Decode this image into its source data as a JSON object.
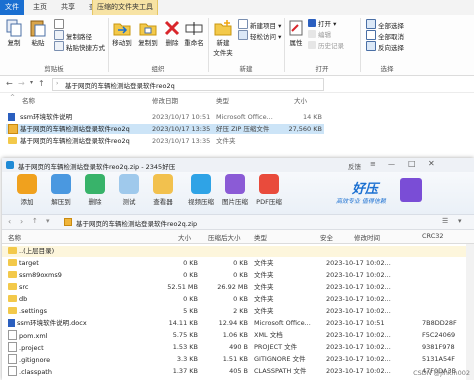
{
  "ribbon": {
    "tabs": [
      "文件",
      "主页",
      "共享",
      "查看",
      "压缩的文件夹工具"
    ],
    "clipboard": {
      "copy": "复制",
      "paste": "粘贴",
      "copy_path": "复制路径",
      "paste_shortcut": "粘贴快捷方式",
      "cut": "剪切",
      "group": "剪贴板"
    },
    "organize": {
      "move_to": "移动到",
      "copy_to": "复制到",
      "delete": "删除",
      "rename": "重命名",
      "group": "组织"
    },
    "new": {
      "new_folder": "新建\n文件夹",
      "new_item": "新建项目",
      "easy_access": "轻松访问",
      "group": "新建"
    },
    "open": {
      "properties": "属性",
      "open": "打开",
      "edit": "编辑",
      "history": "历史记录",
      "group": "打开"
    },
    "select": {
      "select_all": "全部选择",
      "select_none": "全部取消",
      "invert": "反向选择",
      "group": "选择"
    }
  },
  "address": {
    "path": "基于网页的车辆检测站登录软件reo2q"
  },
  "file_list": {
    "headers": [
      "名称",
      "修改日期",
      "类型",
      "大小"
    ],
    "rows": [
      {
        "name": "ssm环境软件说明",
        "date": "2023/10/17 10:51",
        "type": "Microsoft Office...",
        "size": "14 KB"
      },
      {
        "name": "基于网页的车辆检测站登录软件reo2q",
        "date": "2023/10/17 13:35",
        "type": "好压 ZIP 压缩文件",
        "size": "27,560 KB"
      },
      {
        "name": "基于网页的车辆检测站登录软件reo2q",
        "date": "2023/10/17 13:35",
        "type": "文件夹",
        "size": ""
      }
    ]
  },
  "haozip": {
    "title": "基于网页的车辆检测站登录软件reo2q.zip - 2345好压",
    "feedback": "反馈",
    "toolbar": [
      "添加",
      "解压到",
      "删除",
      "测试",
      "查看器",
      "视频压缩",
      "图片压缩",
      "PDF压缩"
    ],
    "brand": "好压",
    "slogan": "高效专业 值得信赖",
    "nav_path": "基于网页的车辆检测站登录软件reo2q.zip",
    "headers": [
      "名称",
      "大小",
      "压缩后大小",
      "类型",
      "安全",
      "修改时间",
      "CRC32"
    ],
    "rows": [
      {
        "name": "..(上层目录)",
        "size": "",
        "packed": "",
        "type": "",
        "date": "",
        "crc": "",
        "kind": "folder"
      },
      {
        "name": "target",
        "size": "0 KB",
        "packed": "0 KB",
        "type": "文件夹",
        "date": "2023-10-17 10:02...",
        "crc": "",
        "kind": "folder"
      },
      {
        "name": "ssm89oxms9",
        "size": "0 KB",
        "packed": "0 KB",
        "type": "文件夹",
        "date": "2023-10-17 10:02...",
        "crc": "",
        "kind": "folder"
      },
      {
        "name": "src",
        "size": "52.51 MB",
        "packed": "26.92 MB",
        "type": "文件夹",
        "date": "2023-10-17 10:02...",
        "crc": "",
        "kind": "folder"
      },
      {
        "name": "db",
        "size": "0 KB",
        "packed": "0 KB",
        "type": "文件夹",
        "date": "2023-10-17 10:02...",
        "crc": "",
        "kind": "folder"
      },
      {
        "name": ".settings",
        "size": "5 KB",
        "packed": "2 KB",
        "type": "文件夹",
        "date": "2023-10-17 10:02...",
        "crc": "",
        "kind": "folder"
      },
      {
        "name": "ssm环境软件说明.docx",
        "size": "14.11 KB",
        "packed": "12.94 KB",
        "type": "Microsoft Office...",
        "date": "2023-10-17 10:51",
        "crc": "7B8DD28F",
        "kind": "word"
      },
      {
        "name": "pom.xml",
        "size": "5.75 KB",
        "packed": "1.06 KB",
        "type": "XML 文档",
        "date": "2023-10-17 10:02...",
        "crc": "F5C24069",
        "kind": "doc"
      },
      {
        "name": ".project",
        "size": "1.53 KB",
        "packed": "490 B",
        "type": "PROJECT 文件",
        "date": "2023-10-17 10:02...",
        "crc": "9381F978",
        "kind": "doc"
      },
      {
        "name": ".gitignore",
        "size": "3.3 KB",
        "packed": "1.51 KB",
        "type": "GITIGNORE 文件",
        "date": "2023-10-17 10:02...",
        "crc": "5131A54F",
        "kind": "doc"
      },
      {
        "name": ".classpath",
        "size": "1.37 KB",
        "packed": "405 B",
        "type": "CLASSPATH 文件",
        "date": "2023-10-17 10:02...",
        "crc": "47F0DA3B",
        "kind": "doc"
      }
    ]
  },
  "watermark": "CSDN @jinkin002"
}
